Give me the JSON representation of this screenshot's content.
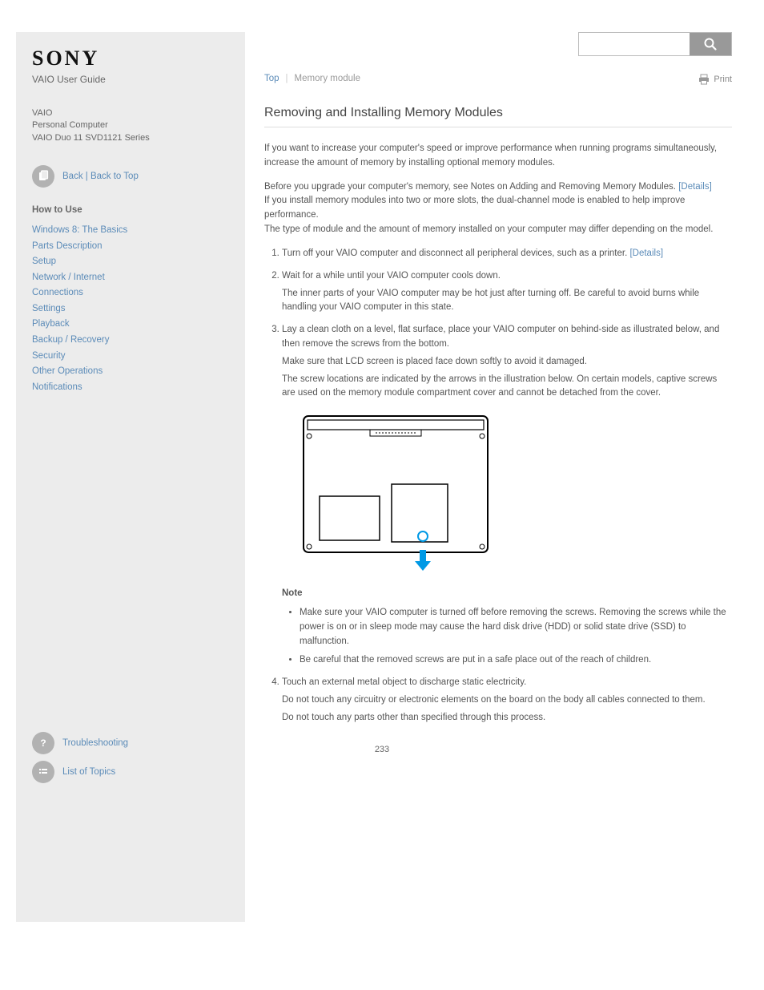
{
  "header": {
    "brand": "SONY",
    "subtitle": "VAIO User Guide",
    "device_line1": "VAIO",
    "device_line2": "Personal Computer",
    "device_line3": "VAIO Duo 11 SVD1121 Series"
  },
  "search": {
    "placeholder": "",
    "button_aria": "Search"
  },
  "sidebar": {
    "back_link": "Back",
    "back_top_link": "Back to Top",
    "how_to_use_title": "How to Use",
    "categories": [
      "Windows 8: The Basics",
      "Parts Description",
      "Setup",
      "Network / Internet",
      "Connections",
      "Settings",
      "Playback",
      "Backup / Recovery",
      "Security",
      "Other Operations",
      "Notifications"
    ],
    "bottom_links": {
      "troubleshooting": "Troubleshooting",
      "list_of_topics": "List of Topics"
    }
  },
  "breadcrumb": {
    "top": "Top",
    "current": "Memory module"
  },
  "print_label": "Print",
  "title": "Removing and Installing Memory Modules",
  "intro": "If you want to increase your computer's speed or improve performance when running programs simultaneously, increase the amount of memory by installing optional memory modules.",
  "before_heading": "Before you upgrade your computer's memory, see",
  "before_link": "Notes on Adding and Removing Memory Modules.",
  "before_link_text": "[Details]",
  "before_rest": "If you install memory modules into two or more slots, the dual-channel mode is enabled to help improve performance.",
  "before_rest2": "The type of module and the amount of memory installed on your computer may differ depending on the model.",
  "steps": [
    {
      "text": "Turn off your VAIO computer and disconnect all peripheral devices, such as a printer.",
      "details": "[Details]"
    },
    {
      "text": "Wait for a while until your VAIO computer cools down.",
      "sub": "The inner parts of your VAIO computer may be hot just after turning off. Be careful to avoid burns while handling your VAIO computer in this state."
    },
    {
      "text": "Lay a clean cloth on a level, flat surface, place your VAIO computer on behind-side as illustrated below, and then remove the screws from the bottom."
    },
    {
      "text": "Make sure that LCD screen is placed face down softly to avoid it damaged.",
      "sub": "The screw locations are indicated by the arrows in the illustration below. On certain models, captive screws are used on the memory module compartment cover and cannot be detached from the cover."
    }
  ],
  "note_heading": "Note",
  "notes": [
    "Make sure your VAIO computer is turned off before removing the screws. Removing the screws while the power is on or in sleep mode may cause the hard disk drive (HDD) or solid state drive (SSD) to malfunction.",
    "Be careful that the removed screws are put in a safe place out of the reach of children."
  ],
  "steps_continued": [
    {
      "num": "4.",
      "text": "Touch an external metal object to discharge static electricity.",
      "sub": "Do not touch any circuitry or electronic elements on the board on the body all cables connected to them."
    },
    {
      "text": "Do not touch any parts other than specified through this process."
    }
  ],
  "page_number": "233"
}
